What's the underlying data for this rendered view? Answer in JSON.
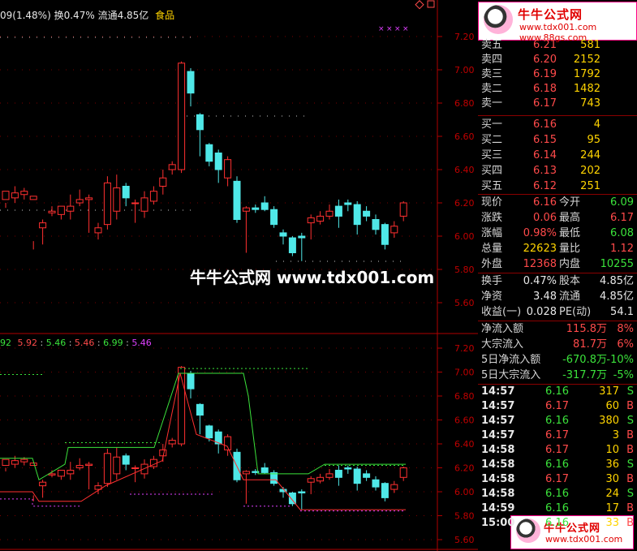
{
  "header": {
    "change_pct": "09(1.48%)",
    "turnover_label": "换",
    "turnover": "0.47%",
    "float_label": "流通",
    "float_value": "4.85亿",
    "sector": "食品"
  },
  "price_axis_top": [
    "7.20",
    "7.00",
    "6.80",
    "6.60",
    "6.40",
    "6.20",
    "6.00",
    "5.80",
    "5.60"
  ],
  "price_axis_bottom": [
    "7.20",
    "7.00",
    "6.80",
    "6.60",
    "6.40",
    "6.20",
    "6.00",
    "5.80",
    "5.60"
  ],
  "indicator_values": [
    "92",
    "5.92",
    "5.46",
    "5.46",
    "6.99",
    "5.46"
  ],
  "watermark": "牛牛公式网 www.tdx001.com",
  "logo_top": {
    "title": "牛牛公式网",
    "url": "www.tdx001.com",
    "url2": "www.88gs.com"
  },
  "logo_bottom": {
    "title": "牛牛公式网",
    "url": "www.tdx001.com"
  },
  "order_book": {
    "asks": [
      {
        "label": "卖五",
        "price": "6.21",
        "vol": "581"
      },
      {
        "label": "卖四",
        "price": "6.20",
        "vol": "2152"
      },
      {
        "label": "卖三",
        "price": "6.19",
        "vol": "1792"
      },
      {
        "label": "卖二",
        "price": "6.18",
        "vol": "1482"
      },
      {
        "label": "卖一",
        "price": "6.17",
        "vol": "743"
      }
    ],
    "bids": [
      {
        "label": "买一",
        "price": "6.16",
        "vol": "4"
      },
      {
        "label": "买二",
        "price": "6.15",
        "vol": "95"
      },
      {
        "label": "买三",
        "price": "6.14",
        "vol": "244"
      },
      {
        "label": "买四",
        "price": "6.13",
        "vol": "202"
      },
      {
        "label": "买五",
        "price": "6.12",
        "vol": "251"
      }
    ]
  },
  "quote": [
    {
      "l1": "现价",
      "v1": "6.16",
      "l2": "今开",
      "v2": "6.09"
    },
    {
      "l1": "涨跌",
      "v1": "0.06",
      "l2": "最高",
      "v2": "6.17"
    },
    {
      "l1": "涨幅",
      "v1": "0.98%",
      "l2": "最低",
      "v2": "6.08"
    },
    {
      "l1": "总量",
      "v1": "22623",
      "l2": "量比",
      "v2": "1.12"
    },
    {
      "l1": "外盘",
      "v1": "12368",
      "l2": "内盘",
      "v2": "10255"
    }
  ],
  "fundamentals": [
    {
      "l1": "换手",
      "v1": "0.47%",
      "l2": "股本",
      "v2": "4.85亿"
    },
    {
      "l1": "净资",
      "v1": "3.48",
      "l2": "流通",
      "v2": "4.85亿"
    },
    {
      "l1": "收益(一)",
      "v1": "0.028",
      "l2": "PE(动)",
      "v2": "54.1"
    }
  ],
  "flows": [
    {
      "label": "净流入额",
      "value": "115.8万",
      "pct": "8%"
    },
    {
      "label": "大宗流入",
      "value": "81.7万",
      "pct": "6%"
    },
    {
      "label": "5日净流入额",
      "value": "-670.8万",
      "pct": "-10%"
    },
    {
      "label": "5日大宗流入",
      "value": "-317.7万",
      "pct": "-5%"
    }
  ],
  "ticks": [
    {
      "time": "14:57",
      "price": "6.16",
      "vol": "317",
      "side": "S"
    },
    {
      "time": "14:57",
      "price": "6.17",
      "vol": "60",
      "side": "B"
    },
    {
      "time": "14:57",
      "price": "6.16",
      "vol": "380",
      "side": "S"
    },
    {
      "time": "14:57",
      "price": "6.17",
      "vol": "3",
      "side": "B"
    },
    {
      "time": "14:58",
      "price": "6.17",
      "vol": "10",
      "side": "B"
    },
    {
      "time": "14:58",
      "price": "6.16",
      "vol": "36",
      "side": "S"
    },
    {
      "time": "14:58",
      "price": "6.17",
      "vol": "30",
      "side": "B"
    },
    {
      "time": "14:58",
      "price": "6.16",
      "vol": "24",
      "side": "S"
    },
    {
      "time": "14:59",
      "price": "6.16",
      "vol": "17",
      "side": "B"
    },
    {
      "time": "15:00",
      "price": "6.16",
      "vol": "33",
      "side": "B"
    }
  ],
  "chart_data": {
    "type": "candlestick",
    "candles": [
      [
        6.22,
        6.27,
        6.17,
        6.2
      ],
      [
        6.23,
        6.26,
        6.2,
        6.3
      ],
      [
        6.25,
        6.27,
        6.22,
        6.29
      ],
      [
        6.22,
        6.24,
        5.92,
        5.97
      ],
      [
        6.05,
        6.08,
        5.95,
        6.1
      ],
      [
        6.14,
        6.15,
        6.12,
        6.18
      ],
      [
        6.13,
        6.18,
        6.1,
        6.18
      ],
      [
        6.15,
        6.18,
        6.1,
        6.25
      ],
      [
        6.2,
        6.22,
        6.18,
        6.28
      ],
      [
        6.22,
        6.23,
        6.02,
        6.25
      ],
      [
        6.02,
        6.05,
        5.98,
        6.08
      ],
      [
        6.07,
        6.32,
        6.04,
        6.36
      ],
      [
        6.15,
        6.29,
        6.1,
        6.37
      ],
      [
        6.3,
        6.23,
        6.18,
        6.32
      ],
      [
        6.2,
        6.2,
        6.08,
        6.22
      ],
      [
        6.15,
        6.23,
        6.11,
        6.27
      ],
      [
        6.21,
        6.27,
        6.19,
        6.3
      ],
      [
        6.3,
        6.35,
        6.25,
        6.4
      ],
      [
        6.4,
        6.43,
        6.37,
        6.45
      ],
      [
        6.4,
        7.04,
        6.38,
        7.05
      ],
      [
        6.99,
        6.86,
        6.78,
        7.01
      ],
      [
        6.73,
        6.64,
        6.48,
        6.74
      ],
      [
        6.55,
        6.45,
        6.42,
        6.56
      ],
      [
        6.5,
        6.4,
        6.32,
        6.52
      ],
      [
        6.35,
        6.46,
        6.3,
        6.48
      ],
      [
        6.33,
        6.1,
        6.08,
        6.36
      ],
      [
        6.15,
        6.17,
        5.9,
        6.18
      ],
      [
        6.17,
        6.16,
        6.14,
        6.19
      ],
      [
        6.2,
        6.16,
        6.15,
        6.24
      ],
      [
        6.16,
        6.07,
        6.05,
        6.18
      ],
      [
        6.02,
        6.0,
        5.95,
        6.04
      ],
      [
        5.99,
        5.9,
        5.88,
        6.0
      ],
      [
        6.0,
        5.99,
        5.85,
        6.02
      ],
      [
        6.08,
        6.11,
        5.98,
        6.13
      ],
      [
        6.09,
        6.12,
        6.07,
        6.15
      ],
      [
        6.12,
        6.15,
        6.1,
        6.19
      ],
      [
        6.18,
        6.12,
        6.05,
        6.22
      ],
      [
        6.2,
        6.19,
        6.15,
        6.22
      ],
      [
        6.19,
        6.07,
        6.01,
        6.21
      ],
      [
        6.15,
        6.12,
        6.09,
        6.18
      ],
      [
        6.1,
        6.04,
        6.01,
        6.13
      ],
      [
        6.07,
        5.95,
        5.92,
        6.08
      ],
      [
        6.02,
        6.06,
        5.99,
        6.09
      ],
      [
        6.12,
        6.2,
        6.09,
        6.21
      ]
    ]
  }
}
